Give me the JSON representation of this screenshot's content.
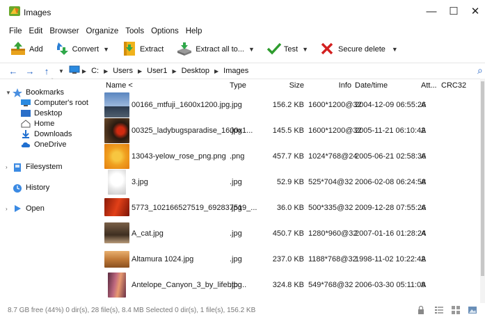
{
  "window": {
    "title": "Images",
    "min": "—",
    "max": "☐",
    "close": "✕"
  },
  "menu": [
    "File",
    "Edit",
    "Browser",
    "Organize",
    "Tools",
    "Options",
    "Help"
  ],
  "toolbar": {
    "add": "Add",
    "convert": "Convert",
    "extract": "Extract",
    "extract_all": "Extract all to...",
    "test": "Test",
    "secure_delete": "Secure delete",
    "caret": "▼"
  },
  "address": {
    "back": "←",
    "forward": "→",
    "up": "↑",
    "dropdown": "▼",
    "crumbs": [
      "C:",
      "Users",
      "User1",
      "Desktop",
      "Images"
    ],
    "sep": "▶",
    "search": "⌕"
  },
  "sidebar": {
    "bookmarks": "Bookmarks",
    "bookmark_items": [
      "Computer's root",
      "Desktop",
      "Home",
      "Downloads",
      "OneDrive"
    ],
    "filesystem": "Filesystem",
    "history": "History",
    "open": "Open"
  },
  "columns": {
    "name": "Name <",
    "type": "Type",
    "size": "Size",
    "info": "Info",
    "datetime": "Date/time",
    "attr": "Att...",
    "crc": "CRC32"
  },
  "files": [
    {
      "name": "00166_mtfuji_1600x1200.jpg",
      "type": ".jpg",
      "size": "156.2 KB",
      "info": "1600*1200@32",
      "date": "2004-12-09 06:55:26",
      "attr": "A"
    },
    {
      "name": "00325_ladybugsparadise_1600x1...",
      "type": ".jpg",
      "size": "145.5 KB",
      "info": "1600*1200@32",
      "date": "2005-11-21 06:10:42",
      "attr": "A"
    },
    {
      "name": "13043-yelow_rose_png.png",
      "type": ".png",
      "size": "457.7 KB",
      "info": "1024*768@24",
      "date": "2005-06-21 02:58:36",
      "attr": "A"
    },
    {
      "name": "3.jpg",
      "type": ".jpg",
      "size": "52.9 KB",
      "info": "525*704@32",
      "date": "2006-02-08 06:24:58",
      "attr": "A"
    },
    {
      "name": "5773_102166527519_692837519_...",
      "type": ".jpg",
      "size": "36.0 KB",
      "info": "500*335@32",
      "date": "2009-12-28 07:55:26",
      "attr": "A"
    },
    {
      "name": "A_cat.jpg",
      "type": ".jpg",
      "size": "450.7 KB",
      "info": "1280*960@32",
      "date": "2007-01-16 01:28:24",
      "attr": "A"
    },
    {
      "name": "Altamura 1024.jpg",
      "type": ".jpg",
      "size": "237.0 KB",
      "info": "1188*768@32",
      "date": "1998-11-02 10:22:42",
      "attr": "A"
    },
    {
      "name": "Antelope_Canyon_3_by_lifebtb....",
      "type": ".jpg",
      "size": "324.8 KB",
      "info": "549*768@32",
      "date": "2006-03-30 05:11:08",
      "attr": "A"
    }
  ],
  "status": {
    "text": "8.7 GB free (44%)    0 dir(s), 28 file(s), 8.4 MB    Selected 0 dir(s), 1 file(s), 156.2 KB"
  },
  "colors": {
    "accent": "#1d5fc4",
    "check": "#2e9c2e",
    "delete": "#d32020"
  }
}
